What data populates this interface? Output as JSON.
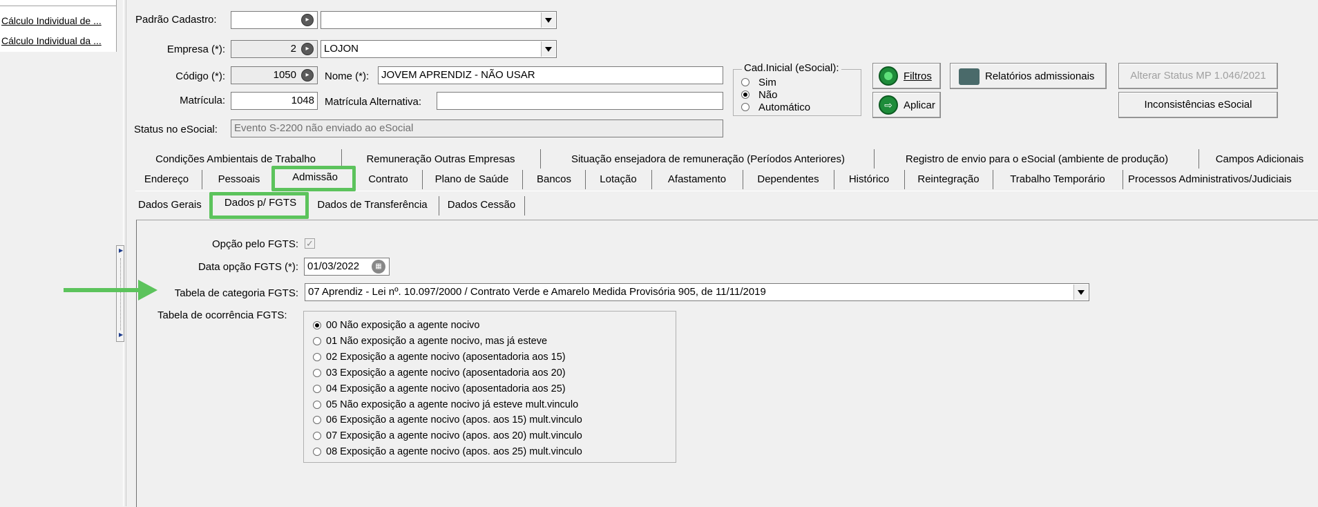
{
  "left_panel": {
    "items": [
      "Cálculo Individual de ...",
      "Cálculo Individual da ..."
    ]
  },
  "form": {
    "padrao_label": "Padrão Cadastro:",
    "padrao_code": "",
    "padrao_desc": "",
    "empresa_label": "Empresa (*):",
    "empresa_code": "2",
    "empresa_desc": "LOJON",
    "codigo_label": "Código (*):",
    "codigo_value": "1050",
    "nome_label": "Nome (*):",
    "nome_value": "JOVEM APRENDIZ -  NÃO USAR",
    "matricula_label": "Matrícula:",
    "matricula_value": "1048",
    "matricula_alt_label": "Matrícula Alternativa:",
    "matricula_alt_value": "",
    "status_label": "Status no eSocial:",
    "status_value": "Evento S-2200 não enviado ao eSocial"
  },
  "cad_inicial": {
    "title": "Cad.Inicial (eSocial):",
    "options": [
      "Sim",
      "Não",
      "Automático"
    ],
    "selected": 1
  },
  "buttons": {
    "filtros": "Filtros",
    "aplicar": "Aplicar",
    "relatorios": "Relatórios admissionais",
    "alterar_status": "Alterar Status MP 1.046/2021",
    "inconsistencias": "Inconsistências eSocial"
  },
  "tabs_row1": [
    "Condições Ambientais de Trabalho",
    "Remuneração Outras Empresas",
    "Situação ensejadora de remuneração (Períodos Anteriores)",
    "Registro de envio para o eSocial (ambiente de produção)",
    "Campos Adicionais"
  ],
  "tabs_row2": [
    "Endereço",
    "Pessoais",
    "Admissão",
    "Contrato",
    "Plano de Saúde",
    "Bancos",
    "Lotação",
    "Afastamento",
    "Dependentes",
    "Histórico",
    "Reintegração",
    "Trabalho Temporário",
    "Processos Administrativos/Judiciais"
  ],
  "subtabs": [
    "Dados Gerais",
    "Dados p/ FGTS",
    "Dados de Transferência",
    "Dados Cessão"
  ],
  "fgts": {
    "opcao_label": "Opção pelo FGTS:",
    "opcao_checked": true,
    "data_label": "Data opção FGTS (*):",
    "data_value": "01/03/2022",
    "categoria_label": "Tabela de categoria FGTS:",
    "categoria_value": "07 Aprendiz - Lei nº. 10.097/2000 / Contrato Verde e Amarelo Medida Provisória 905, de 11/11/2019",
    "ocorrencia_label": "Tabela de ocorrência FGTS:",
    "ocorrencia_options": [
      "00 Não exposição a agente nocivo",
      "01 Não exposição a agente nocivo, mas já esteve",
      "02 Exposição a agente nocivo (aposentadoria aos 15)",
      "03 Exposição a agente nocivo (aposentadoria aos 20)",
      "04 Exposição a agente nocivo (aposentadoria aos 25)",
      "05 Não exposição a agente nocivo já esteve mult.vinculo",
      "06 Exposição a agente nocivo (apos. aos 15) mult.vinculo",
      "07 Exposição a agente nocivo (apos. aos 20) mult.vinculo",
      "08 Exposição a agente nocivo (apos. aos 25) mult.vinculo"
    ],
    "ocorrencia_selected": 0
  },
  "colors": {
    "highlight": "#5cc35c",
    "background": "#f0f0f0"
  }
}
